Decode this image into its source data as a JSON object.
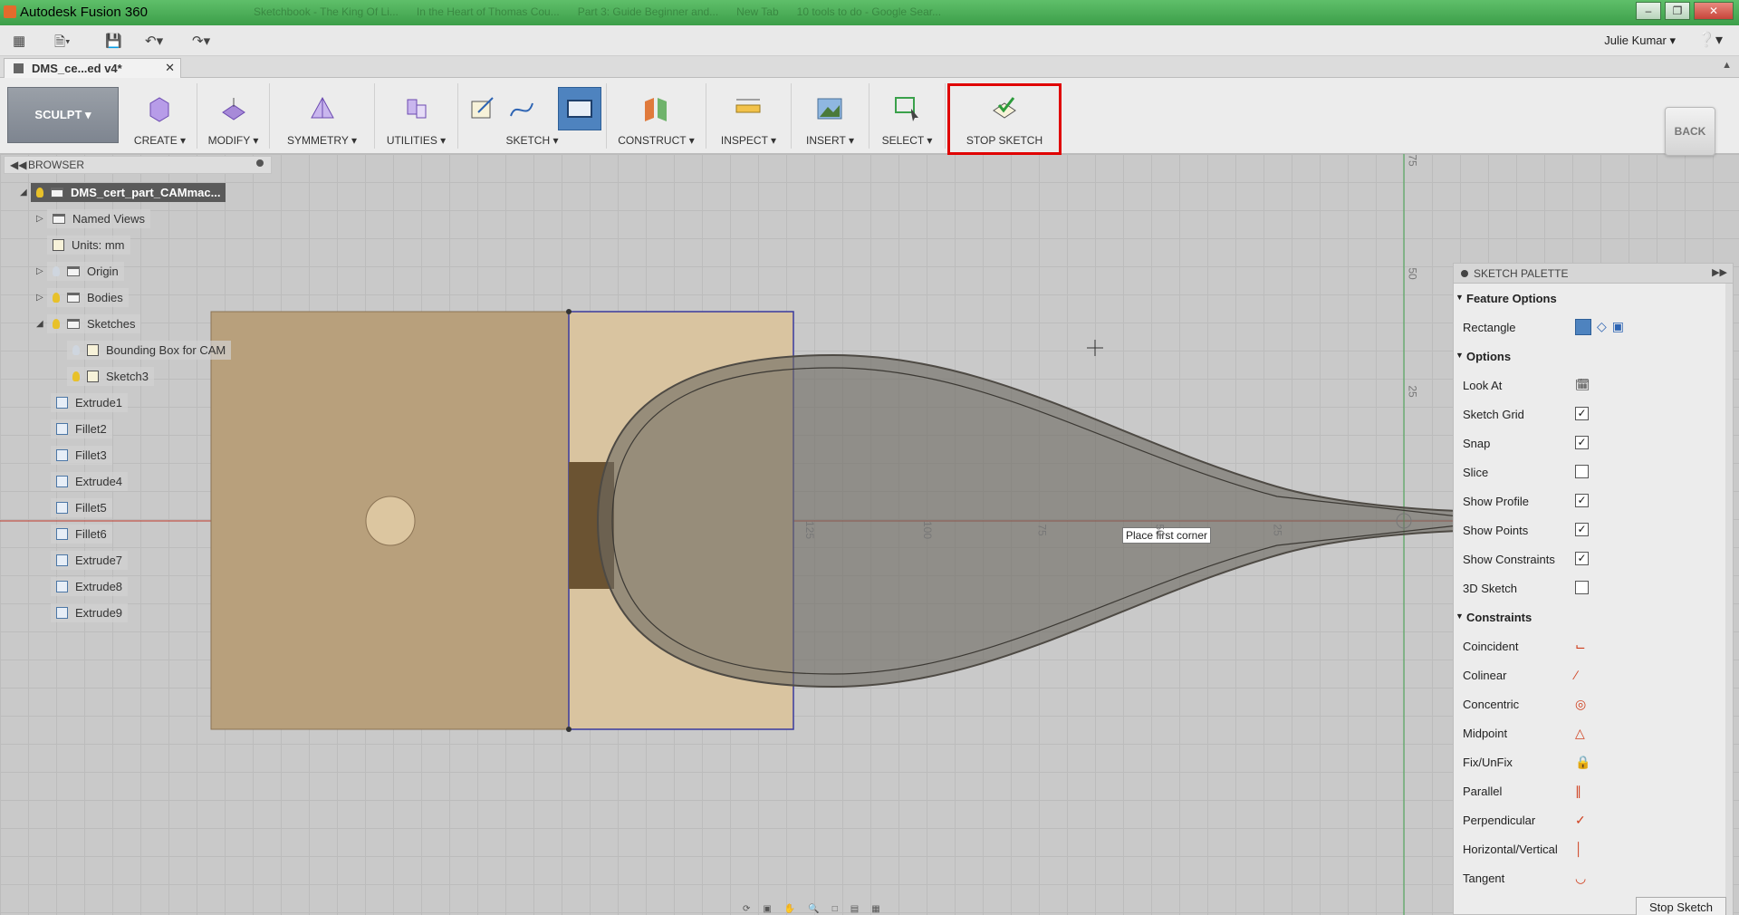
{
  "app": {
    "title": "Autodesk Fusion 360"
  },
  "browser_tabs": [
    "Sketchbook - The King Of Li...",
    "In the Heart of Thomas Cou...",
    "Part 3: Guide Beginner and...",
    "New Tab",
    "10 tools to do - Google Sear..."
  ],
  "user": {
    "name": "Julie Kumar"
  },
  "document_tab": {
    "label": "DMS_ce...ed v4*"
  },
  "ribbon": {
    "workspace": "SCULPT",
    "groups": [
      "CREATE",
      "MODIFY",
      "SYMMETRY",
      "UTILITIES",
      "SKETCH",
      "CONSTRUCT",
      "INSPECT",
      "INSERT",
      "SELECT",
      "STOP SKETCH"
    ],
    "back": "BACK"
  },
  "browser": {
    "title": "BROWSER",
    "root": "DMS_cert_part_CAMmac...",
    "items": [
      "Named Views",
      "Units: mm",
      "Origin",
      "Bodies",
      "Sketches",
      "Bounding Box for CAM",
      "Sketch3",
      "Extrude1",
      "Fillet2",
      "Fillet3",
      "Extrude4",
      "Fillet5",
      "Fillet6",
      "Extrude7",
      "Extrude8",
      "Extrude9"
    ]
  },
  "canvas": {
    "tooltip": "Place first corner",
    "ruler_h": [
      "125",
      "100",
      "75",
      "50",
      "25"
    ],
    "ruler_v": [
      "75",
      "50",
      "25"
    ],
    "colors": {
      "block": "#b8a07c",
      "block_light": "#d9c4a0",
      "spoon": "#8f8a80",
      "sketch_line": "#3b3b9e",
      "axis_red": "#c0392b",
      "axis_green": "#3fa14b"
    }
  },
  "palette": {
    "title": "SKETCH PALETTE",
    "feature_options": "Feature Options",
    "rectangle": "Rectangle",
    "options_title": "Options",
    "options": [
      {
        "label": "Look At",
        "type": "button"
      },
      {
        "label": "Sketch Grid",
        "checked": true
      },
      {
        "label": "Snap",
        "checked": true
      },
      {
        "label": "Slice",
        "checked": false
      },
      {
        "label": "Show Profile",
        "checked": true
      },
      {
        "label": "Show Points",
        "checked": true
      },
      {
        "label": "Show Constraints",
        "checked": true
      },
      {
        "label": "3D Sketch",
        "checked": false
      }
    ],
    "constraints_title": "Constraints",
    "constraints": [
      "Coincident",
      "Colinear",
      "Concentric",
      "Midpoint",
      "Fix/UnFix",
      "Parallel",
      "Perpendicular",
      "Horizontal/Vertical",
      "Tangent"
    ],
    "stop_button": "Stop Sketch"
  }
}
